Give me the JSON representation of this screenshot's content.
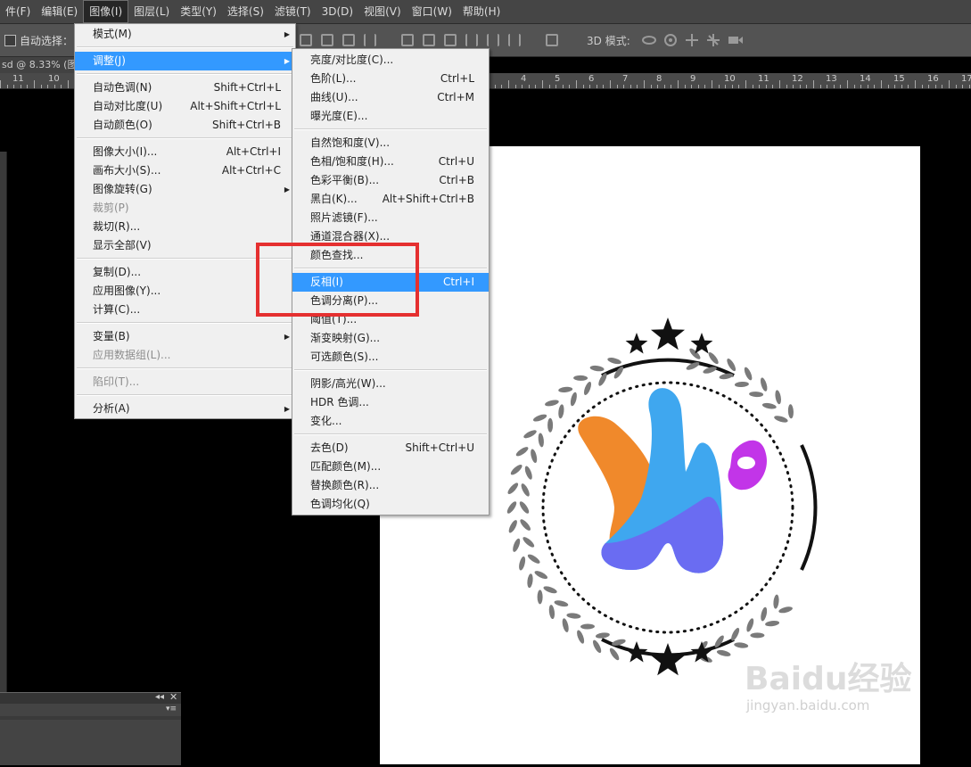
{
  "menubar": {
    "items": [
      "件(F)",
      "编辑(E)",
      "图像(I)",
      "图层(L)",
      "类型(Y)",
      "选择(S)",
      "滤镜(T)",
      "3D(D)",
      "视图(V)",
      "窗口(W)",
      "帮助(H)"
    ],
    "active_index": 2
  },
  "options_bar": {
    "auto_select_label": "自动选择：",
    "mode_3d_label": "3D 模式:"
  },
  "document": {
    "tab_title": "sd @ 8.33% (图"
  },
  "ruler": {
    "labels": [
      "11",
      "10",
      "4",
      "5",
      "6",
      "7",
      "8",
      "9",
      "10",
      "11",
      "12",
      "13",
      "14",
      "15",
      "16",
      "17"
    ]
  },
  "image_menu": {
    "items": [
      {
        "label": "模式(M)",
        "shortcut": "",
        "submenu": true,
        "disabled": false
      },
      {
        "sep": true
      },
      {
        "label": "调整(J)",
        "shortcut": "",
        "submenu": true,
        "disabled": false,
        "highlighted": true
      },
      {
        "sep": true
      },
      {
        "label": "自动色调(N)",
        "shortcut": "Shift+Ctrl+L"
      },
      {
        "label": "自动对比度(U)",
        "shortcut": "Alt+Shift+Ctrl+L"
      },
      {
        "label": "自动颜色(O)",
        "shortcut": "Shift+Ctrl+B"
      },
      {
        "sep": true
      },
      {
        "label": "图像大小(I)...",
        "shortcut": "Alt+Ctrl+I"
      },
      {
        "label": "画布大小(S)...",
        "shortcut": "Alt+Ctrl+C"
      },
      {
        "label": "图像旋转(G)",
        "shortcut": "",
        "submenu": true
      },
      {
        "label": "裁剪(P)",
        "shortcut": "",
        "disabled": true
      },
      {
        "label": "裁切(R)...",
        "shortcut": ""
      },
      {
        "label": "显示全部(V)",
        "shortcut": ""
      },
      {
        "sep": true
      },
      {
        "label": "复制(D)...",
        "shortcut": ""
      },
      {
        "label": "应用图像(Y)...",
        "shortcut": ""
      },
      {
        "label": "计算(C)...",
        "shortcut": ""
      },
      {
        "sep": true
      },
      {
        "label": "变量(B)",
        "shortcut": "",
        "submenu": true
      },
      {
        "label": "应用数据组(L)...",
        "shortcut": "",
        "disabled": true
      },
      {
        "sep": true
      },
      {
        "label": "陷印(T)...",
        "shortcut": "",
        "disabled": true
      },
      {
        "sep": true
      },
      {
        "label": "分析(A)",
        "shortcut": "",
        "submenu": true
      }
    ]
  },
  "adjust_menu": {
    "items": [
      {
        "label": "亮度/对比度(C)...",
        "shortcut": ""
      },
      {
        "label": "色阶(L)...",
        "shortcut": "Ctrl+L"
      },
      {
        "label": "曲线(U)...",
        "shortcut": "Ctrl+M"
      },
      {
        "label": "曝光度(E)...",
        "shortcut": ""
      },
      {
        "sep": true
      },
      {
        "label": "自然饱和度(V)...",
        "shortcut": ""
      },
      {
        "label": "色相/饱和度(H)...",
        "shortcut": "Ctrl+U"
      },
      {
        "label": "色彩平衡(B)...",
        "shortcut": "Ctrl+B"
      },
      {
        "label": "黑白(K)...",
        "shortcut": "Alt+Shift+Ctrl+B"
      },
      {
        "label": "照片滤镜(F)...",
        "shortcut": ""
      },
      {
        "label": "通道混合器(X)...",
        "shortcut": ""
      },
      {
        "label": "颜色查找...",
        "shortcut": ""
      },
      {
        "sep": true
      },
      {
        "label": "反相(I)",
        "shortcut": "Ctrl+I",
        "highlighted": true
      },
      {
        "label": "色调分离(P)...",
        "shortcut": ""
      },
      {
        "label": "阈值(T)...",
        "shortcut": ""
      },
      {
        "label": "渐变映射(G)...",
        "shortcut": ""
      },
      {
        "label": "可选颜色(S)...",
        "shortcut": ""
      },
      {
        "sep": true
      },
      {
        "label": "阴影/高光(W)...",
        "shortcut": ""
      },
      {
        "label": "HDR 色调...",
        "shortcut": ""
      },
      {
        "label": "变化...",
        "shortcut": ""
      },
      {
        "sep": true
      },
      {
        "label": "去色(D)",
        "shortcut": "Shift+Ctrl+U"
      },
      {
        "label": "匹配颜色(M)...",
        "shortcut": ""
      },
      {
        "label": "替换颜色(R)...",
        "shortcut": ""
      },
      {
        "label": "色调均化(Q)",
        "shortcut": ""
      }
    ]
  },
  "colors": {
    "highlight": "#3399ff",
    "annotation": "#e53030",
    "logo_orange": "#f0892b",
    "logo_blue": "#3fa7ef",
    "logo_purple": "#6a6cf2",
    "logo_magenta": "#c235e8",
    "laurel": "#7a7a7a"
  },
  "watermark": {
    "text": "Baidu经验",
    "url": "jingyan.baidu.com"
  }
}
